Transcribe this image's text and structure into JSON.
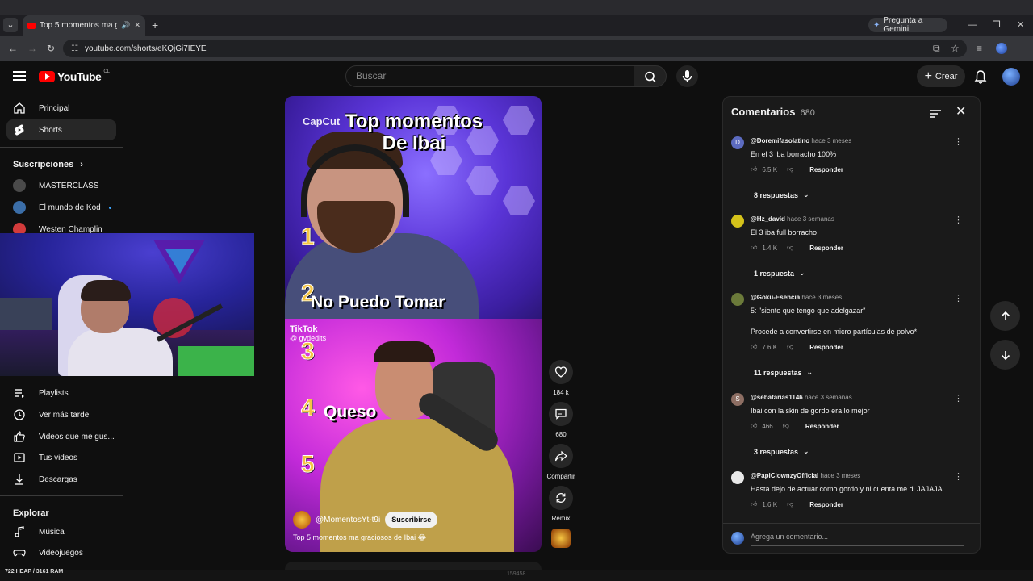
{
  "browser": {
    "tab_title": "Top 5 momentos ma graciosos de Ibai",
    "url": "youtube.com/shorts/eKQjGi7IEYE",
    "gemini_label": "Pregunta a Gemini"
  },
  "header": {
    "logo_text": "YouTube",
    "country": "CL",
    "search_placeholder": "Buscar",
    "create_label": "Crear"
  },
  "sidebar": {
    "main": [
      {
        "label": "Principal",
        "icon": "home-icon"
      },
      {
        "label": "Shorts",
        "icon": "shorts-icon"
      }
    ],
    "subscriptions_header": "Suscripciones",
    "subscriptions": [
      {
        "label": "MASTERCLASS",
        "color": "#5a5a5a"
      },
      {
        "label": "El mundo de Kod",
        "color": "#3b6ea8"
      },
      {
        "label": "Westen Champlin",
        "color": "#d23b3b"
      }
    ],
    "you": [
      {
        "label": "Playlists",
        "icon": "playlist-icon"
      },
      {
        "label": "Ver más tarde",
        "icon": "clock-icon"
      },
      {
        "label": "Videos que me gus...",
        "icon": "like-icon"
      },
      {
        "label": "Tus videos",
        "icon": "video-icon"
      },
      {
        "label": "Descargas",
        "icon": "download-icon"
      }
    ],
    "explore_header": "Explorar",
    "explore": [
      {
        "label": "Música",
        "icon": "music-icon"
      },
      {
        "label": "Videojuegos",
        "icon": "gamepad-icon"
      }
    ]
  },
  "short": {
    "overlay_title_line1": "Top momentos",
    "overlay_title_line2": "De Ibai",
    "capcut": "CapCut",
    "items": [
      {
        "num": "1",
        "label": ""
      },
      {
        "num": "2",
        "label": "No Puedo Tomar"
      },
      {
        "num": "3",
        "label": ""
      },
      {
        "num": "4",
        "label": "Queso"
      },
      {
        "num": "5",
        "label": ""
      }
    ],
    "tiktok_brand": "TikTok",
    "tiktok_handle": "@ gvdedits",
    "channel": "@MomentosYt-t9i",
    "subscribe_label": "Suscribirse",
    "title": "Top 5 momentos ma graciosos de Ibai 😂"
  },
  "actions": {
    "likes": "184 k",
    "comments": "680",
    "share": "Compartir",
    "remix": "Remix"
  },
  "comments": {
    "title": "Comentarios",
    "count": "680",
    "input_placeholder": "Agrega un comentario...",
    "reply_label": "Responder",
    "list": [
      {
        "user": "@Doremifasolatino",
        "date": "hace 3 meses",
        "text": "En el 3 iba borracho 100%",
        "likes": "6.5 K",
        "replies": "8 respuestas",
        "avatar_letter": "D",
        "avatar_color": "#5c6bc0"
      },
      {
        "user": "@Hz_david",
        "date": "hace 3 semanas",
        "text": "El 3 iba full borracho",
        "likes": "1.4 K",
        "replies": "1 respuesta",
        "avatar_letter": "",
        "avatar_color": "#d4c21a"
      },
      {
        "user": "@Goku-Esencia",
        "date": "hace 3 meses",
        "text": "5:  \"siento que tengo que adelgazar\"",
        "text2": "Procede a convertirse en micro partículas de polvo*",
        "likes": "7.6 K",
        "replies": "11 respuestas",
        "avatar_letter": "",
        "avatar_color": "#6b7a3a"
      },
      {
        "user": "@sebafarias1146",
        "date": "hace 3 semanas",
        "text": "Ibai con la skin de gordo era lo mejor",
        "likes": "466",
        "replies": "3 respuestas",
        "avatar_letter": "S",
        "avatar_color": "#8d6e63"
      },
      {
        "user": "@PapiClownzyOfficial",
        "date": "hace 3 meses",
        "text": "Hasta dejo de actuar como gordo y ni cuenta me di JAJAJA",
        "likes": "1.6 K",
        "replies": "",
        "avatar_letter": "",
        "avatar_color": "#e8e8e8"
      }
    ]
  },
  "stats": {
    "heap": "722 HEAP / 3161 RAM",
    "center": "159458"
  }
}
